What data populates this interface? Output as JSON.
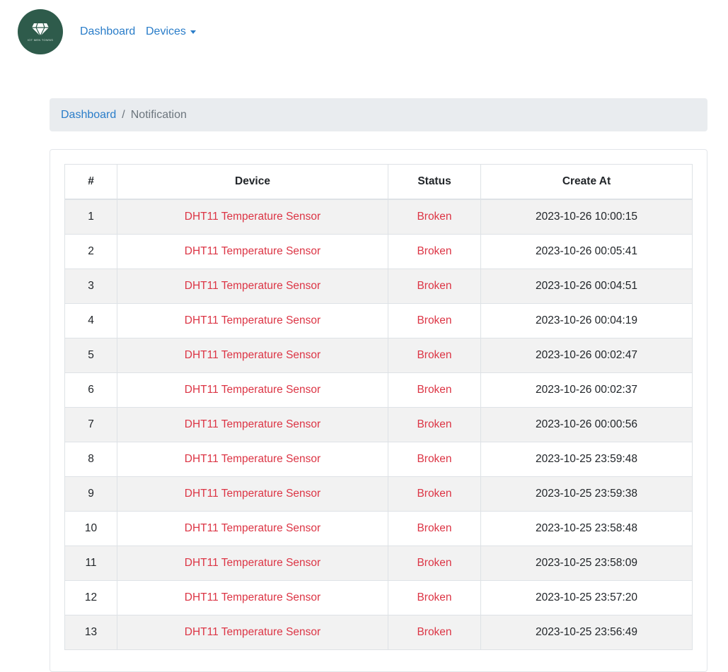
{
  "nav": {
    "logo_text": "IOT MEN TOWNS",
    "dashboard": "Dashboard",
    "devices": "Devices"
  },
  "breadcrumb": {
    "home": "Dashboard",
    "separator": "/",
    "current": "Notification"
  },
  "table": {
    "headers": [
      "#",
      "Device",
      "Status",
      "Create At"
    ],
    "rows": [
      {
        "num": "1",
        "device": "DHT11 Temperature Sensor",
        "status": "Broken",
        "created": "2023-10-26 10:00:15"
      },
      {
        "num": "2",
        "device": "DHT11 Temperature Sensor",
        "status": "Broken",
        "created": "2023-10-26 00:05:41"
      },
      {
        "num": "3",
        "device": "DHT11 Temperature Sensor",
        "status": "Broken",
        "created": "2023-10-26 00:04:51"
      },
      {
        "num": "4",
        "device": "DHT11 Temperature Sensor",
        "status": "Broken",
        "created": "2023-10-26 00:04:19"
      },
      {
        "num": "5",
        "device": "DHT11 Temperature Sensor",
        "status": "Broken",
        "created": "2023-10-26 00:02:47"
      },
      {
        "num": "6",
        "device": "DHT11 Temperature Sensor",
        "status": "Broken",
        "created": "2023-10-26 00:02:37"
      },
      {
        "num": "7",
        "device": "DHT11 Temperature Sensor",
        "status": "Broken",
        "created": "2023-10-26 00:00:56"
      },
      {
        "num": "8",
        "device": "DHT11 Temperature Sensor",
        "status": "Broken",
        "created": "2023-10-25 23:59:48"
      },
      {
        "num": "9",
        "device": "DHT11 Temperature Sensor",
        "status": "Broken",
        "created": "2023-10-25 23:59:38"
      },
      {
        "num": "10",
        "device": "DHT11 Temperature Sensor",
        "status": "Broken",
        "created": "2023-10-25 23:58:48"
      },
      {
        "num": "11",
        "device": "DHT11 Temperature Sensor",
        "status": "Broken",
        "created": "2023-10-25 23:58:09"
      },
      {
        "num": "12",
        "device": "DHT11 Temperature Sensor",
        "status": "Broken",
        "created": "2023-10-25 23:57:20"
      },
      {
        "num": "13",
        "device": "DHT11 Temperature Sensor",
        "status": "Broken",
        "created": "2023-10-25 23:56:49"
      }
    ]
  },
  "colors": {
    "link": "#2a7dc9",
    "danger": "#dc3545",
    "logo_bg": "#2e5b4b",
    "breadcrumb_bg": "#e9ecef"
  }
}
